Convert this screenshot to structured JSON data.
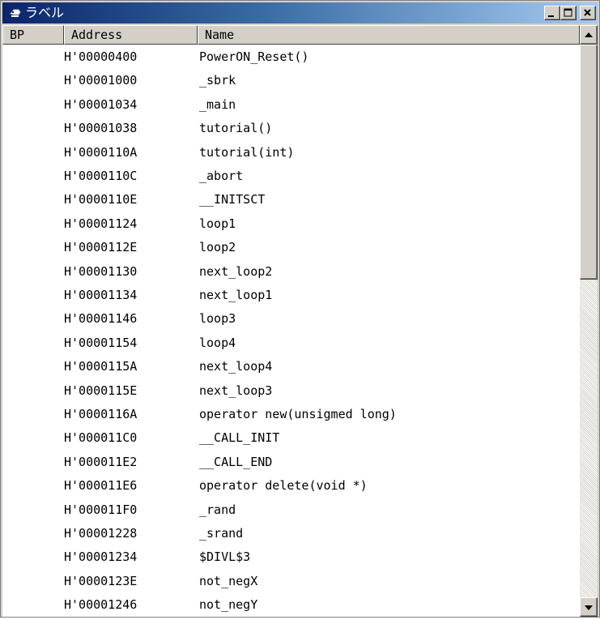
{
  "window": {
    "title": "ラベル",
    "icon": "label-window-icon",
    "buttons": [
      "minimize",
      "maximize",
      "close"
    ]
  },
  "columns": {
    "bp": "BP",
    "address": "Address",
    "name": "Name"
  },
  "rows": [
    {
      "address": "H'00000400",
      "name": "PowerON_Reset()"
    },
    {
      "address": "H'00001000",
      "name": "_sbrk"
    },
    {
      "address": "H'00001034",
      "name": "_main"
    },
    {
      "address": "H'00001038",
      "name": "tutorial()"
    },
    {
      "address": "H'0000110A",
      "name": "tutorial(int)"
    },
    {
      "address": "H'0000110C",
      "name": "_abort"
    },
    {
      "address": "H'0000110E",
      "name": "__INITSCT"
    },
    {
      "address": "H'00001124",
      "name": "loop1"
    },
    {
      "address": "H'0000112E",
      "name": "loop2"
    },
    {
      "address": "H'00001130",
      "name": "next_loop2"
    },
    {
      "address": "H'00001134",
      "name": "next_loop1"
    },
    {
      "address": "H'00001146",
      "name": "loop3"
    },
    {
      "address": "H'00001154",
      "name": "loop4"
    },
    {
      "address": "H'0000115A",
      "name": "next_loop4"
    },
    {
      "address": "H'0000115E",
      "name": "next_loop3"
    },
    {
      "address": "H'0000116A",
      "name": "operator new(unsigmed long)"
    },
    {
      "address": "H'000011C0",
      "name": "__CALL_INIT"
    },
    {
      "address": "H'000011E2",
      "name": "__CALL_END"
    },
    {
      "address": "H'000011E6",
      "name": "operator delete(void *)"
    },
    {
      "address": "H'000011F0",
      "name": "_rand"
    },
    {
      "address": "H'00001228",
      "name": "_srand"
    },
    {
      "address": "H'00001234",
      "name": "$DIVL$3"
    },
    {
      "address": "H'0000123E",
      "name": "not_negX"
    },
    {
      "address": "H'00001246",
      "name": "not_negY"
    }
  ],
  "colors": {
    "title_start": "#0a246a",
    "title_end": "#a6caf0",
    "face": "#d4d0c8",
    "list_bg": "#ffffff"
  }
}
